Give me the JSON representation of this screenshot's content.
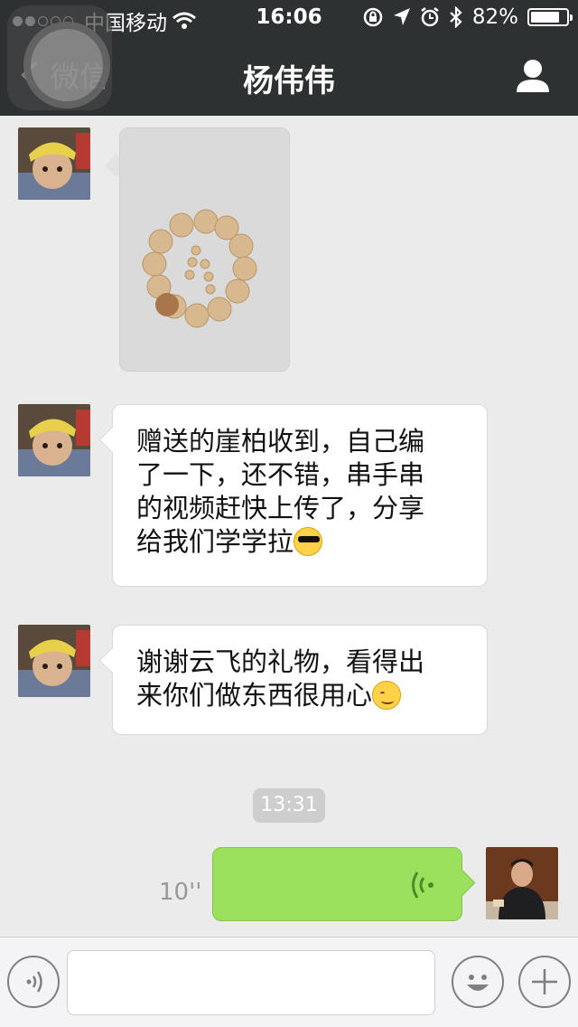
{
  "status_bar": {
    "carrier": "中国移动",
    "time": "16:06",
    "battery": "82%",
    "battery_level": 0.82
  },
  "nav": {
    "back_label": "微信",
    "title": "杨伟伟"
  },
  "messages": [
    {
      "type": "image",
      "sender": "contact",
      "content": "bracelet-photo"
    },
    {
      "type": "text",
      "sender": "contact",
      "lines": [
        "赠送的崖柏收到，自己编",
        "了一下，还不错，串手串",
        "的视频赶快上传了，分享",
        "给我们学学拉"
      ],
      "emoji": "sunglasses-emoji"
    },
    {
      "type": "text",
      "sender": "contact",
      "lines": [
        "谢谢云飞的礼物，看得出",
        "来你们做东西很用心"
      ],
      "emoji": "smiling-emoji"
    },
    {
      "type": "timestamp",
      "text": "13:31"
    },
    {
      "type": "voice",
      "sender": "me",
      "duration": "10''"
    }
  ],
  "icons": [
    "signal-dots",
    "wifi-icon",
    "lock-rotation-icon",
    "location-icon",
    "alarm-icon",
    "bluetooth-icon",
    "battery-icon",
    "back-chevron-icon",
    "person-icon",
    "voice-wave-icon",
    "voice-toggle-icon",
    "emoji-icon",
    "plus-icon"
  ],
  "colors": {
    "nav_bg": "#2e3132",
    "chat_bg": "#ebebeb",
    "voice_bubble": "#9be15d",
    "text_bubble": "#ffffff"
  }
}
